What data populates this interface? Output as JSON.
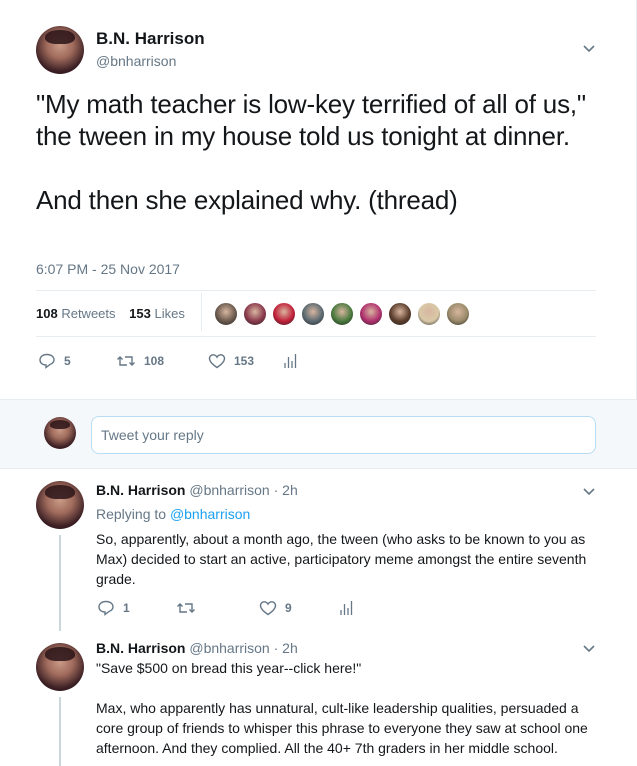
{
  "main": {
    "name": "B.N. Harrison",
    "handle": "@bnharrison",
    "text": "\"My math teacher is low-key terrified of all of us,\" the tween in my house told us tonight at dinner.\n\nAnd then she explained why. (thread)",
    "date": "6:07 PM - 25 Nov 2017",
    "retweets_count": "108",
    "retweets_label": "Retweets",
    "likes_count": "153",
    "likes_label": "Likes",
    "actions": {
      "reply": "5",
      "retweet": "108",
      "like": "153"
    },
    "liker_colors": [
      "#6b5a4e",
      "#8a3a4c",
      "#c2213a",
      "#5b6a72",
      "#4a7a3e",
      "#b0306e",
      "#5c3d2c",
      "#d9c9a8",
      "#9a8a6a"
    ]
  },
  "reply_box": {
    "placeholder": "Tweet your reply"
  },
  "replies": [
    {
      "name": "B.N. Harrison",
      "handle": "@bnharrison",
      "time": "· 2h",
      "replying_prefix": "Replying to",
      "replying_to": "@bnharrison",
      "text": "So, apparently, about a month ago, the tween (who asks to be known to you as Max) decided to start an active, participatory meme amongst the entire seventh grade.",
      "actions": {
        "reply": "1",
        "retweet": "",
        "like": "9"
      }
    },
    {
      "name": "B.N. Harrison",
      "handle": "@bnharrison",
      "time": "· 2h",
      "text": "\"Save $500 on bread this year--click here!\"\n\nMax, who apparently has unnatural, cult-like leadership qualities, persuaded a core group of friends to whisper this phrase to everyone they saw at school one afternoon. And they complied. All the 40+ 7th graders  in her middle school."
    }
  ],
  "colors": {
    "link": "#1da1f2",
    "muted": "#657786",
    "text": "#14171a"
  }
}
